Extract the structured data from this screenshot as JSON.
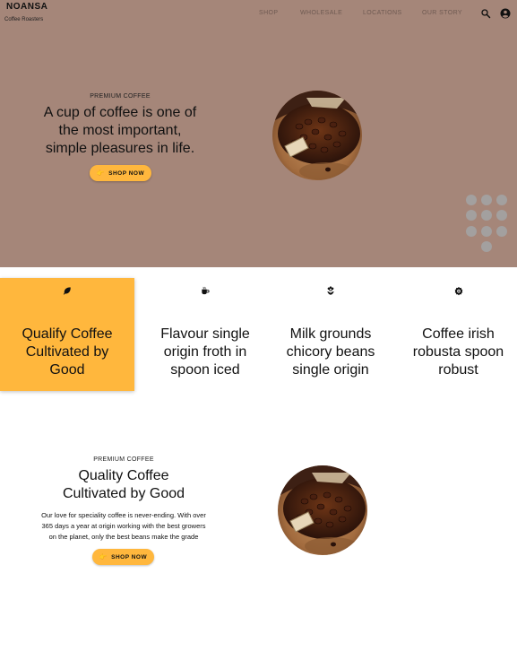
{
  "header": {
    "brand": "NOANSA",
    "brand_sub": "Coffee Roasters",
    "nav": [
      "SHOP",
      "WHOLESALE",
      "LOCATIONS",
      "OUR STORY"
    ],
    "icons": [
      "search-icon",
      "account-icon"
    ]
  },
  "hero": {
    "eyebrow": "PREMIUM COFFEE",
    "title_lines": [
      "A cup of coffee is one of",
      "the most important,",
      "simple pleasures in life."
    ],
    "button_label": "SHOP NOW",
    "button_icon": "hand-point-icon",
    "image": "coffee-beans-in-sack-with-scoop"
  },
  "features": [
    {
      "icon": "leaf-icon",
      "lines": [
        "Qualify Coffee",
        "Cultivated by",
        "Good"
      ],
      "highlighted": true
    },
    {
      "icon": "coffee-cup-icon",
      "lines": [
        "Flavour single",
        "origin froth in",
        "spoon iced"
      ],
      "highlighted": false
    },
    {
      "icon": "flower-icon",
      "lines": [
        "Milk grounds",
        "chicory beans",
        "single origin"
      ],
      "highlighted": false
    },
    {
      "icon": "badge-icon",
      "lines": [
        "Coffee irish",
        "robusta spoon",
        "robust"
      ],
      "highlighted": false
    }
  ],
  "about": {
    "eyebrow": "PREMIUM COFFEE",
    "title_lines": [
      "Quality Coffee",
      "Cultivated by Good"
    ],
    "body_lines": [
      "Our love for speciality coffee is never-ending. With over",
      "365 days a year at origin working with the best growers",
      "on the planet, only the best beans make the grade"
    ],
    "button_label": "SHOP NOW",
    "image": "coffee-beans-in-sack-with-scoop"
  },
  "colors": {
    "brown": "#a58679",
    "accent": "#ffb73d",
    "dots": "#a3a09f"
  }
}
